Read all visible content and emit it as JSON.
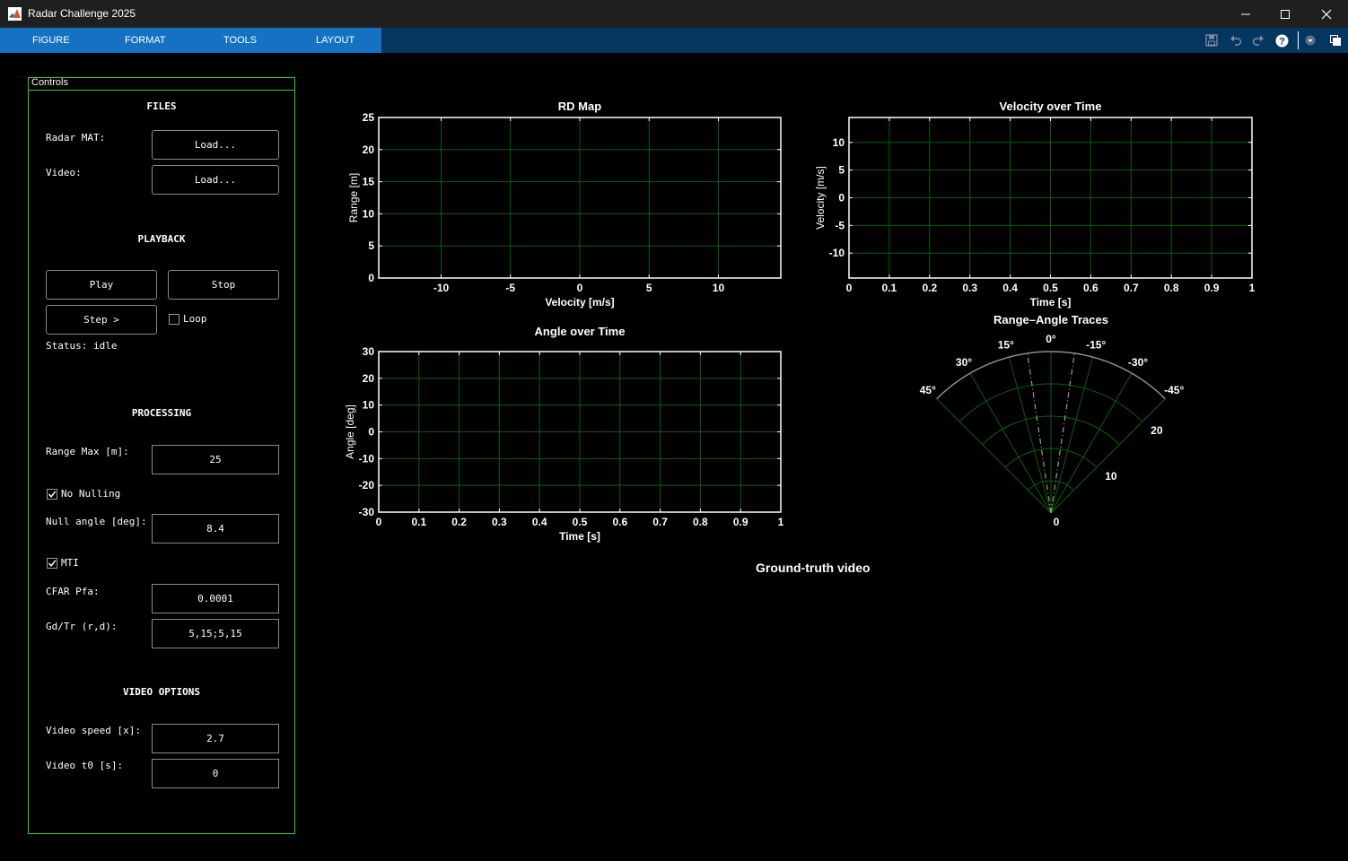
{
  "window": {
    "title": "Radar Challenge 2025",
    "icons": [
      "matlab-logo-icon",
      "minimize-icon",
      "maximize-icon",
      "close-icon"
    ]
  },
  "toolstrip": {
    "tabs": [
      "FIGURE",
      "FORMAT",
      "TOOLS",
      "LAYOUT"
    ],
    "quick_access_icons": [
      "save-icon",
      "undo-icon",
      "redo-icon",
      "help-icon",
      "collapse-menu-icon",
      "undock-icon"
    ]
  },
  "controls": {
    "title": "Controls",
    "files": {
      "heading": "FILES",
      "radar_label": "Radar MAT:",
      "radar_button": "Load...",
      "video_label": "Video:",
      "video_button": "Load..."
    },
    "playback": {
      "heading": "PLAYBACK",
      "play": "Play",
      "stop": "Stop",
      "step": "Step >",
      "loop_label": "Loop",
      "loop_checked": false,
      "status": "Status: idle"
    },
    "processing": {
      "heading": "PROCESSING",
      "range_max_label": "Range Max [m]:",
      "range_max_value": "25",
      "no_nulling_label": "No Nulling",
      "no_nulling_checked": true,
      "null_angle_label": "Null angle [deg]:",
      "null_angle_value": "8.4",
      "mti_label": "MTI",
      "mti_checked": true,
      "cfar_label": "CFAR Pfa:",
      "cfar_value": "0.0001",
      "gdtr_label": "Gd/Tr (r,d):",
      "gdtr_value": "5,15;5,15"
    },
    "video_options": {
      "heading": "VIDEO OPTIONS",
      "speed_label": "Video speed [x]:",
      "speed_value": "2.7",
      "t0_label": "Video t0 [s]:",
      "t0_value": "0"
    }
  },
  "colors": {
    "background": "#000000",
    "grid": "#0b5e0b",
    "panel_border": "#2bd32b",
    "tab_bar": "#1572c2",
    "toolstrip": "#04365f",
    "polar_rim": "#8c8c8c",
    "trace": "#9a9a9a"
  },
  "chart_data": [
    {
      "type": "line",
      "title": "RD Map",
      "xlabel": "Velocity [m/s]",
      "ylabel": "Range [m]",
      "xlim": [
        -14.5,
        14.5
      ],
      "ylim": [
        0,
        25
      ],
      "xticks": [
        -10,
        -5,
        0,
        5,
        10
      ],
      "xtick_labels": [
        "-10",
        "-5",
        "0",
        "5",
        "10"
      ],
      "yticks": [
        0,
        5,
        10,
        15,
        20,
        25
      ],
      "ytick_labels": [
        "0",
        "5",
        "10",
        "15",
        "20",
        "25"
      ],
      "grid": true,
      "series": []
    },
    {
      "type": "line",
      "title": "Velocity over Time",
      "xlabel": "Time [s]",
      "ylabel": "Velocity [m/s]",
      "xlim": [
        0,
        1
      ],
      "ylim": [
        -14.5,
        14.5
      ],
      "xticks": [
        0,
        0.1,
        0.2,
        0.3,
        0.4,
        0.5,
        0.6,
        0.7,
        0.8,
        0.9,
        1
      ],
      "xtick_labels": [
        "0",
        "0.1",
        "0.2",
        "0.3",
        "0.4",
        "0.5",
        "0.6",
        "0.7",
        "0.8",
        "0.9",
        "1"
      ],
      "yticks": [
        -10,
        -5,
        0,
        5,
        10
      ],
      "ytick_labels": [
        "-10",
        "-5",
        "0",
        "5",
        "10"
      ],
      "grid": true,
      "series": []
    },
    {
      "type": "line",
      "title": "Angle over Time",
      "xlabel": "Time [s]",
      "ylabel": "Angle [deg]",
      "xlim": [
        0,
        1
      ],
      "ylim": [
        -30,
        30
      ],
      "xticks": [
        0,
        0.1,
        0.2,
        0.3,
        0.4,
        0.5,
        0.6,
        0.7,
        0.8,
        0.9,
        1
      ],
      "xtick_labels": [
        "0",
        "0.1",
        "0.2",
        "0.3",
        "0.4",
        "0.5",
        "0.6",
        "0.7",
        "0.8",
        "0.9",
        "1"
      ],
      "yticks": [
        -30,
        -20,
        -10,
        0,
        10,
        20,
        30
      ],
      "ytick_labels": [
        "-30",
        "-20",
        "-10",
        "0",
        "10",
        "20",
        "30"
      ],
      "grid": true,
      "series": []
    },
    {
      "type": "polar",
      "title": "Range–Angle Traces",
      "theta_range_deg": [
        -45,
        45
      ],
      "theta_ticks": [
        45,
        30,
        15,
        0,
        -15,
        -30,
        -45
      ],
      "theta_tick_labels": [
        "45°",
        "30°",
        "15°",
        "0°",
        "-15°",
        "-30°",
        "-45°"
      ],
      "r_max": 25,
      "r_ticks": [
        0,
        10,
        20
      ],
      "r_tick_labels": [
        "0",
        "10",
        "20"
      ],
      "null_angle_deg": 8.4,
      "null_lines_deg": [
        8.4,
        -8.4
      ],
      "grid": true
    }
  ],
  "video": {
    "title": "Ground-truth video"
  }
}
